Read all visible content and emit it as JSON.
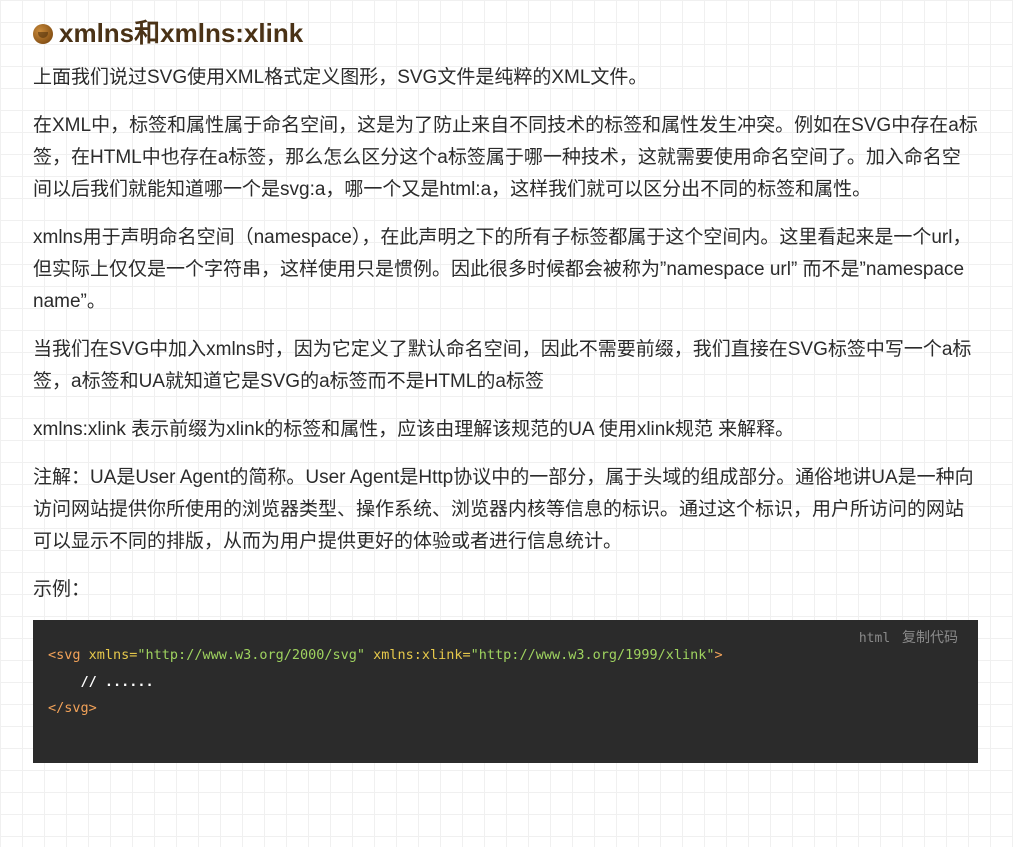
{
  "heading": {
    "text": "xmlns和xmlns:xlink",
    "icon": "brown-bullet-icon"
  },
  "paragraphs": [
    "上面我们说过SVG使用XML格式定义图形，SVG文件是纯粹的XML文件。",
    "在XML中，标签和属性属于命名空间，这是为了防止来自不同技术的标签和属性发生冲突。例如在SVG中存在a标签，在HTML中也存在a标签，那么怎么区分这个a标签属于哪一种技术，这就需要使用命名空间了。加入命名空间以后我们就能知道哪一个是svg:a，哪一个又是html:a，这样我们就可以区分出不同的标签和属性。",
    "xmlns用于声明命名空间（namespace），在此声明之下的所有子标签都属于这个空间内。这里看起来是一个url，但实际上仅仅是一个字符串，这样使用只是惯例。因此很多时候都会被称为”namespace url” 而不是”namespace name”。",
    "当我们在SVG中加入xmlns时，因为它定义了默认命名空间，因此不需要前缀，我们直接在SVG标签中写一个a标签，a标签和UA就知道它是SVG的a标签而不是HTML的a标签",
    "xmlns:xlink 表示前缀为xlink的标签和属性，应该由理解该规范的UA 使用xlink规范 来解释。",
    "注解：UA是User Agent的简称。User Agent是Http协议中的一部分，属于头域的组成部分。通俗地讲UA是一种向访问网站提供你所使用的浏览器类型、操作系统、浏览器内核等信息的标识。通过这个标识，用户所访问的网站可以显示不同的排版，从而为用户提供更好的体验或者进行信息统计。",
    "示例："
  ],
  "code": {
    "lang": "html",
    "copy_label": "复制代码",
    "line1": {
      "open": "<svg",
      "attr1": " xmlns=",
      "val1": "\"http://www.w3.org/2000/svg\"",
      "attr2": " xmlns:xlink=",
      "val2": "\"http://www.w3.org/1999/xlink\"",
      "close": ">"
    },
    "line2": "    // ......",
    "line3": "</svg>"
  },
  "colors": {
    "heading": "#4a3216",
    "code_bg": "#2b2b2b",
    "tag": "#f2a259",
    "attr": "#e6c84b",
    "string": "#9fd35f"
  }
}
